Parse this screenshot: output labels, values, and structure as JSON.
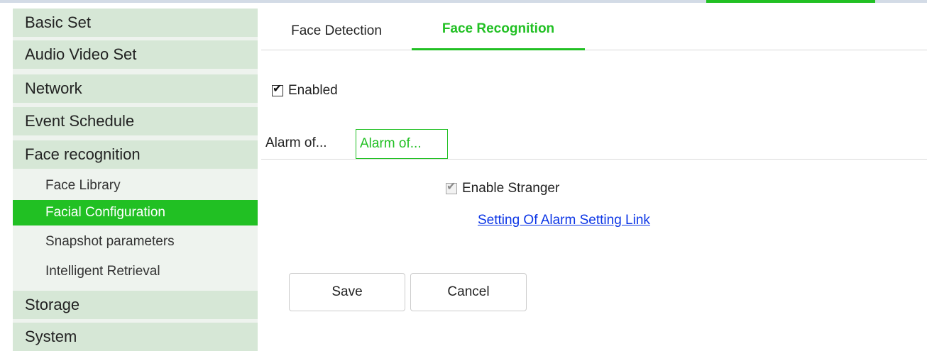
{
  "sidebar": {
    "items": [
      {
        "label": "Basic Set"
      },
      {
        "label": "Audio Video Set"
      },
      {
        "label": "Network"
      },
      {
        "label": "Event Schedule"
      },
      {
        "label": "Face recognition"
      },
      {
        "label": "Storage"
      },
      {
        "label": "System"
      }
    ],
    "face_recognition_subitems": [
      {
        "label": "Face Library",
        "active": false
      },
      {
        "label": "Facial Configuration",
        "active": true
      },
      {
        "label": "Snapshot parameters",
        "active": false
      },
      {
        "label": "Intelligent Retrieval",
        "active": false
      }
    ]
  },
  "tabs": [
    {
      "label": "Face Detection",
      "active": false
    },
    {
      "label": "Face Recognition",
      "active": true
    }
  ],
  "enabled": {
    "label": "Enabled",
    "checked": true
  },
  "subtabs": [
    {
      "label": "Alarm of...",
      "active": false
    },
    {
      "label": "Alarm of...",
      "active": true
    }
  ],
  "stranger": {
    "label": "Enable Stranger",
    "checked": true,
    "disabled": true
  },
  "alarm_link": {
    "label": "Setting Of Alarm Setting Link"
  },
  "buttons": {
    "save": "Save",
    "cancel": "Cancel"
  },
  "colors": {
    "accent": "#21c023",
    "menu_background": "#d6e7d6",
    "sidebar_background": "#eef3ee",
    "link": "#0b35e6"
  },
  "icons": {
    "checkmark": "check-icon"
  }
}
